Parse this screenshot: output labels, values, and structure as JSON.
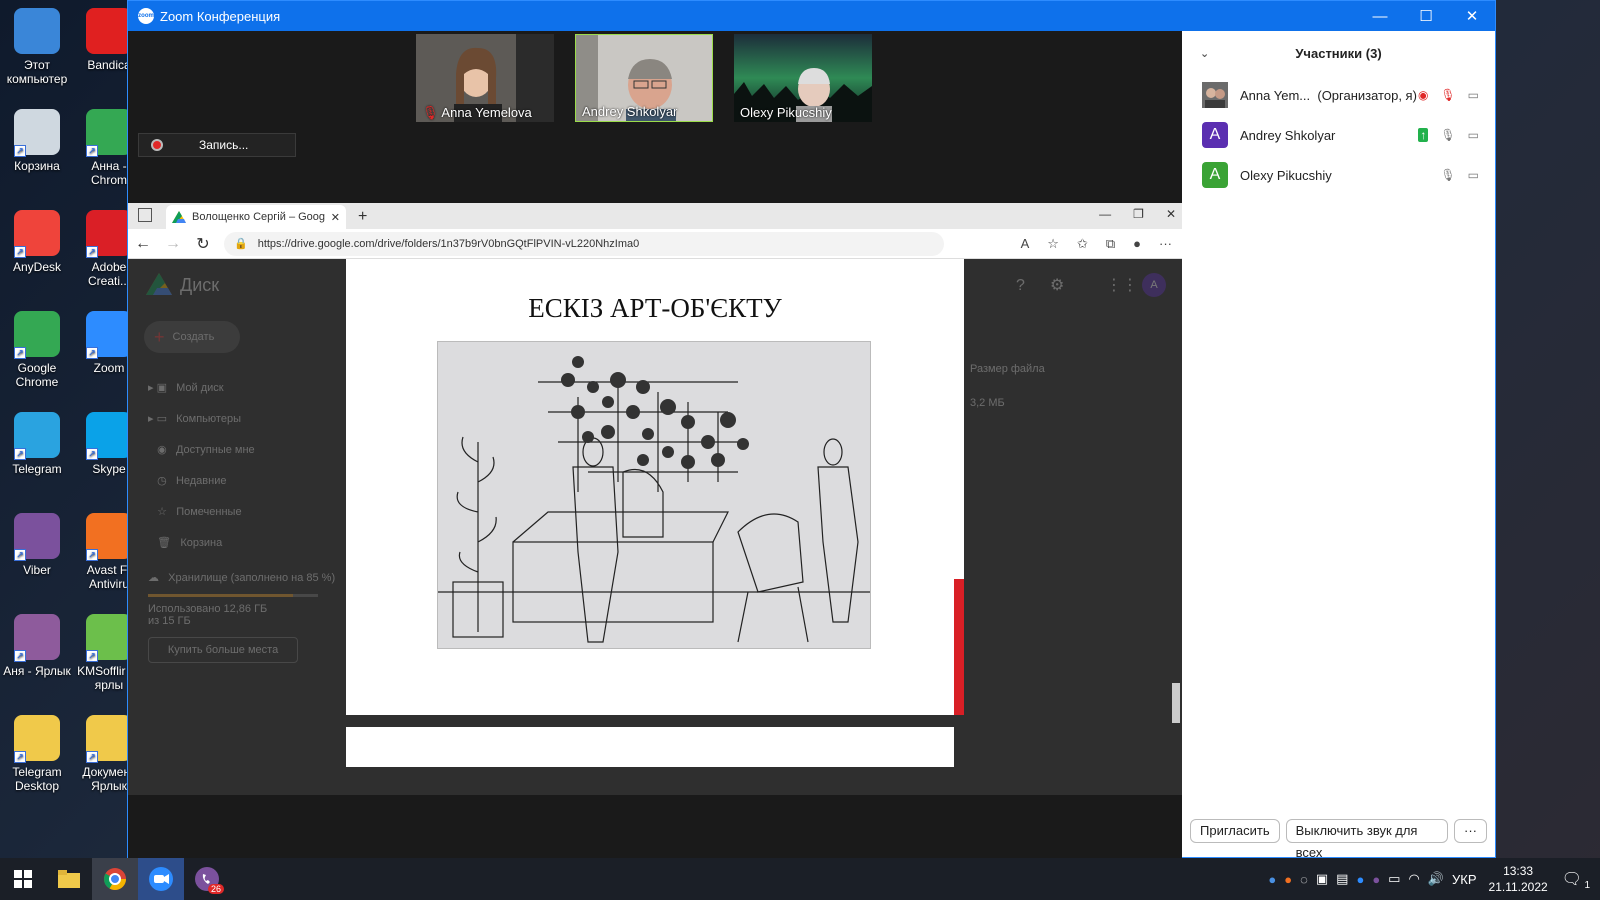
{
  "desktop": {
    "icons": [
      {
        "label": "Этот компьютер",
        "icon": "computer-icon",
        "color": "#3a86d8"
      },
      {
        "label": "Bandica",
        "icon": "bandicam-icon",
        "color": "#e02020"
      },
      {
        "label": "Корзина",
        "icon": "recycle-bin-icon",
        "color": "#cfd8e0"
      },
      {
        "label": "Анна - Chrom",
        "icon": "chrome-icon",
        "color": "#34a853"
      },
      {
        "label": "AnyDesk",
        "icon": "anydesk-icon",
        "color": "#ef443b"
      },
      {
        "label": "Adobe Creati...",
        "icon": "adobe-cc-icon",
        "color": "#da1f26"
      },
      {
        "label": "Google Chrome",
        "icon": "chrome-icon",
        "color": "#34a853"
      },
      {
        "label": "Zoom",
        "icon": "zoom-icon",
        "color": "#2d8cff"
      },
      {
        "label": "Telegram",
        "icon": "telegram-icon",
        "color": "#2aa3e0"
      },
      {
        "label": "Skype",
        "icon": "skype-icon",
        "color": "#0aa2e8"
      },
      {
        "label": "Viber",
        "icon": "viber-icon",
        "color": "#7b519d"
      },
      {
        "label": "Avast Fr Antiviru",
        "icon": "avast-icon",
        "color": "#f27021"
      },
      {
        "label": "Аня - Ярлык",
        "icon": "winrar-icon",
        "color": "#8e5b9c"
      },
      {
        "label": "KMSofflir — ярлы",
        "icon": "kms-icon",
        "color": "#6cbf4b"
      },
      {
        "label": "Telegram Desktop",
        "icon": "folder-icon",
        "color": "#f0c94a"
      },
      {
        "label": "Документ Ярлык",
        "icon": "document-icon",
        "color": "#f0c94a"
      }
    ]
  },
  "zoom": {
    "title": "Zoom Конференция",
    "logo_text": "zoom",
    "window_controls": [
      "—",
      "☐",
      "✕"
    ],
    "videos": [
      {
        "name": "Anna Yemelova",
        "muted": true
      },
      {
        "name": "Andrey Shkolyar",
        "speaking": true
      },
      {
        "name": "Olexy Pikucshiy"
      }
    ],
    "recording_label": "Запись...",
    "accent": "#0e71eb"
  },
  "browser": {
    "tab_title": "Волощенко Сергій – Google Д",
    "url": "https://drive.google.com/drive/folders/1n37b9rV0bnGQtFlPVIN-vL220NhzIma0",
    "drive": {
      "app_name": "Диск",
      "create": "Создать",
      "nav": [
        "Мой диск",
        "Компьютеры",
        "Доступные мне",
        "Недавние",
        "Помеченные",
        "Корзина"
      ],
      "storage": "Хранилище (заполнено на 85 %)",
      "storage_used": "Использовано 12,86 ГБ из 15 ГБ",
      "storage_fill": 0.85,
      "buy": "Купить больше места",
      "col_header": "Размер файла",
      "file_size": "3,2 МБ"
    },
    "slide_title": "ЕСКІЗ АРТ-ОБ'ЄКТУ"
  },
  "participants": {
    "header": "Участники (3)",
    "list": [
      {
        "name": "Anna Yem...",
        "role": "(Организатор, я)",
        "avatar": "",
        "color": "#555555"
      },
      {
        "name": "Andrey Shkolyar",
        "role": "",
        "avatar": "A",
        "color": "#5b2fb1"
      },
      {
        "name": "Olexy Pikucshiy",
        "role": "",
        "avatar": "A",
        "color": "#3aa335"
      }
    ],
    "invite": "Пригласить",
    "mute_all": "Выключить звук для всех",
    "more": "···"
  },
  "taskbar": {
    "lang": "УКР",
    "time": "13:33",
    "date": "21.11.2022",
    "viber_badge": "26",
    "notif_count": "1"
  }
}
